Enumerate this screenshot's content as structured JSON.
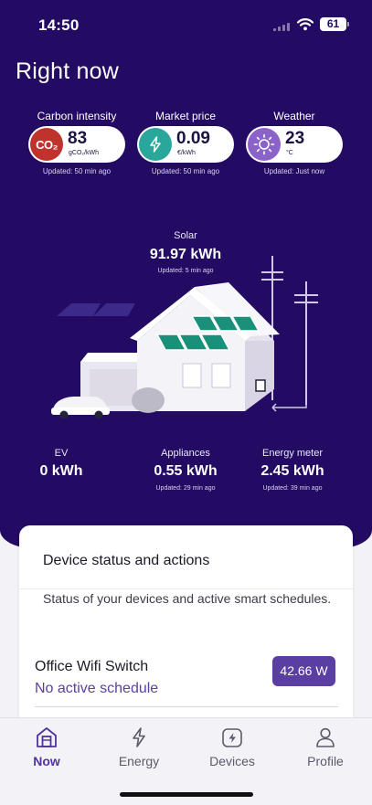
{
  "status_bar": {
    "time": "14:50",
    "battery": "61"
  },
  "page_title": "Right now",
  "metrics": [
    {
      "label": "Carbon intensity",
      "value": "83",
      "unit": "gCO₂/kWh",
      "icon": "co2-icon",
      "icon_text": "CO₂",
      "updated": "Updated: 50 min ago",
      "color": "#c0332d"
    },
    {
      "label": "Market price",
      "value": "0.09",
      "unit": "€/kWh",
      "icon": "lightning-icon",
      "updated": "Updated: 50 min ago",
      "color": "#2aa79b"
    },
    {
      "label": "Weather",
      "value": "23",
      "unit": "°C",
      "icon": "sun-icon",
      "updated": "Updated: Just now",
      "color": "#8a62c9"
    }
  ],
  "solar": {
    "label": "Solar",
    "value": "91.97 kWh",
    "updated": "Updated: 5 min ago"
  },
  "stats": [
    {
      "label": "EV",
      "value": "0 kWh",
      "updated": ""
    },
    {
      "label": "Appliances",
      "value": "0.55 kWh",
      "updated": "Updated: 29 min ago"
    },
    {
      "label": "Energy meter",
      "value": "2.45 kWh",
      "updated": "Updated: 39 min ago"
    }
  ],
  "card": {
    "title": "Device status and actions",
    "description": "Status of your devices and active smart schedules.",
    "device": {
      "name": "Office Wifi Switch",
      "schedule": "No active schedule",
      "power": "42.66 W"
    }
  },
  "nav": [
    {
      "label": "Now",
      "icon": "home-icon",
      "active": true
    },
    {
      "label": "Energy",
      "icon": "lightning-icon",
      "active": false
    },
    {
      "label": "Devices",
      "icon": "device-icon",
      "active": false
    },
    {
      "label": "Profile",
      "icon": "profile-icon",
      "active": false
    }
  ],
  "colors": {
    "hero_bg": "#230b63",
    "accent": "#5b3ea1",
    "co2": "#c0332d",
    "price": "#2aa79b",
    "weather": "#8a62c9"
  }
}
